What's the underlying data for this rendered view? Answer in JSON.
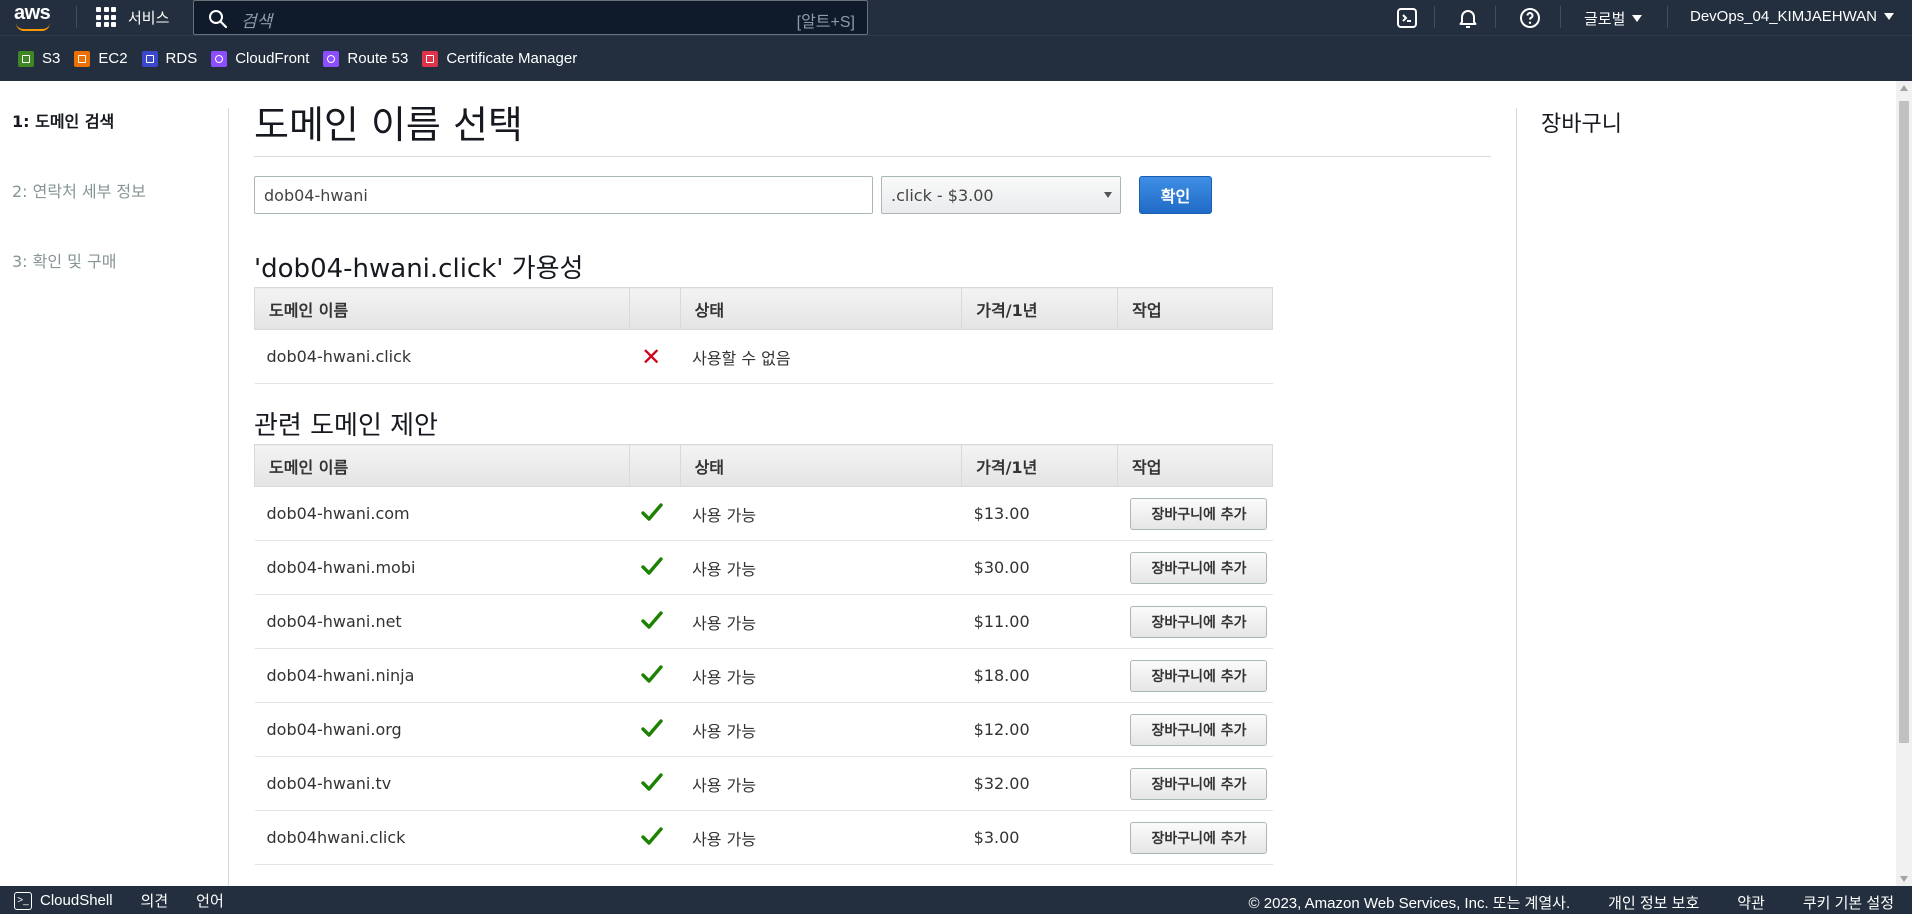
{
  "topnav": {
    "logo_text": "aws",
    "services_label": "서비스",
    "search_placeholder": "검색",
    "search_shortcut": "[알트+S]",
    "region_label": "글로벌",
    "account_label": "DevOps_04_KIMJAEHWAN"
  },
  "favorites": [
    {
      "label": "S3",
      "color": "#3f8624"
    },
    {
      "label": "EC2",
      "color": "#ed7100"
    },
    {
      "label": "RDS",
      "color": "#3b48cc"
    },
    {
      "label": "CloudFront",
      "color": "#8c4fff"
    },
    {
      "label": "Route 53",
      "color": "#8c4fff"
    },
    {
      "label": "Certificate Manager",
      "color": "#dd344c"
    }
  ],
  "steps": [
    {
      "label": "1: 도메인 검색",
      "active": true
    },
    {
      "label": "2: 연락처 세부 정보",
      "active": false
    },
    {
      "label": "3: 확인 및 구매",
      "active": false
    }
  ],
  "main": {
    "title": "도메인 이름 선택",
    "domain_input_value": "dob04-hwani",
    "tld_selected": ".click - $3.00",
    "confirm_label": "확인"
  },
  "availability": {
    "title": "'dob04-hwani.click' 가용성",
    "headers": {
      "name": "도메인 이름",
      "icon": "",
      "status": "상태",
      "price": "가격/1년",
      "action": "작업"
    },
    "rows": [
      {
        "name": "dob04-hwani.click",
        "available": false,
        "status": "사용할 수 없음",
        "price": "",
        "action": ""
      }
    ]
  },
  "related": {
    "title": "관련 도메인 제안",
    "headers": {
      "name": "도메인 이름",
      "icon": "",
      "status": "상태",
      "price": "가격/1년",
      "action": "작업"
    },
    "rows": [
      {
        "name": "dob04-hwani.com",
        "available": true,
        "status": "사용 가능",
        "price": "$13.00",
        "action": "장바구니에 추가"
      },
      {
        "name": "dob04-hwani.mobi",
        "available": true,
        "status": "사용 가능",
        "price": "$30.00",
        "action": "장바구니에 추가"
      },
      {
        "name": "dob04-hwani.net",
        "available": true,
        "status": "사용 가능",
        "price": "$11.00",
        "action": "장바구니에 추가"
      },
      {
        "name": "dob04-hwani.ninja",
        "available": true,
        "status": "사용 가능",
        "price": "$18.00",
        "action": "장바구니에 추가"
      },
      {
        "name": "dob04-hwani.org",
        "available": true,
        "status": "사용 가능",
        "price": "$12.00",
        "action": "장바구니에 추가"
      },
      {
        "name": "dob04-hwani.tv",
        "available": true,
        "status": "사용 가능",
        "price": "$32.00",
        "action": "장바구니에 추가"
      },
      {
        "name": "dob04hwani.click",
        "available": true,
        "status": "사용 가능",
        "price": "$3.00",
        "action": "장바구니에 추가"
      }
    ]
  },
  "cart": {
    "title": "장바구니"
  },
  "footer": {
    "cloudshell_label": "CloudShell",
    "feedback_label": "의견",
    "language_label": "언어",
    "copyright": "© 2023, Amazon Web Services, Inc. 또는 계열사.",
    "privacy_label": "개인 정보 보호",
    "terms_label": "약관",
    "cookie_label": "쿠키 기본 설정"
  }
}
